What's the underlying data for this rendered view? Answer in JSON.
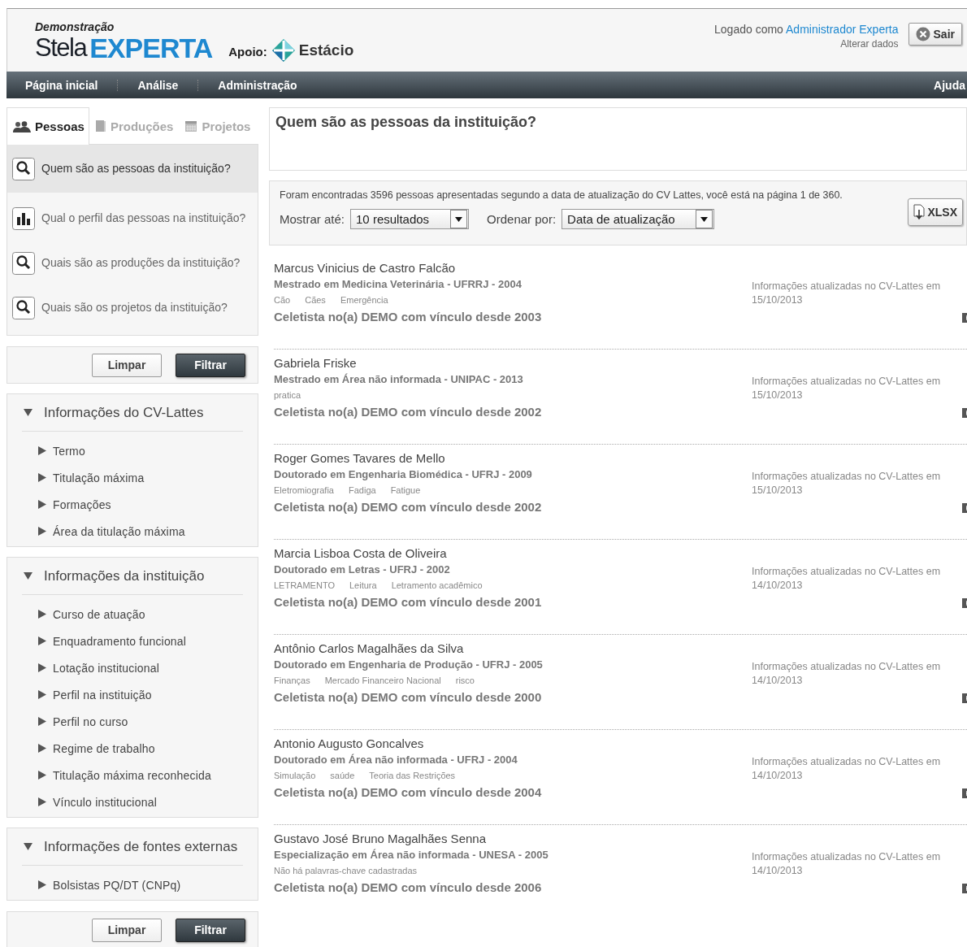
{
  "header": {
    "demo_label": "Demonstração",
    "logo_left": "Stela",
    "logo_right": "EXPERTA",
    "sponsor_label": "Apoio:",
    "sponsor_name": "Estácio",
    "login_prefix": "Logado como",
    "user_name": "Administrador Experta",
    "edit_link": "Alterar dados",
    "logout_button": "Sair"
  },
  "nav": {
    "items": [
      "Página inicial",
      "Análise",
      "Administração"
    ],
    "help": "Ajuda"
  },
  "tabs": [
    {
      "label": "Pessoas",
      "kind": "people",
      "selected": true
    },
    {
      "label": "Produções",
      "kind": "book",
      "selected": false
    },
    {
      "label": "Projetos",
      "kind": "calendar",
      "selected": false
    }
  ],
  "questions": [
    {
      "label": "Quem são as pessoas da instituição?",
      "kind": "search",
      "selected": true
    },
    {
      "label": "Qual o perfil das pessoas na instituição?",
      "kind": "chart",
      "selected": false
    },
    {
      "label": "Quais são as produções da instituição?",
      "kind": "search",
      "selected": false
    },
    {
      "label": "Quais são os projetos da instituição?",
      "kind": "search",
      "selected": false
    }
  ],
  "filter_buttons": {
    "clear": "Limpar",
    "apply": "Filtrar"
  },
  "filter_groups": [
    {
      "title": "Informações do CV-Lattes",
      "expanded": true,
      "items": [
        {
          "label": "Termo",
          "expanded": false
        },
        {
          "label": "Titulação máxima",
          "expanded": false
        },
        {
          "label": "Formações",
          "expanded": false
        },
        {
          "label": "Área da titulação máxima",
          "expanded": false
        }
      ]
    },
    {
      "title": "Informações da instituição",
      "expanded": true,
      "items": [
        {
          "label": "Curso de atuação",
          "expanded": false
        },
        {
          "label": "Enquadramento funcional",
          "expanded": false
        },
        {
          "label": "Lotação institucional",
          "expanded": false
        },
        {
          "label": "Perfil na instituição",
          "expanded": false
        },
        {
          "label": "Perfil no curso",
          "expanded": false
        },
        {
          "label": "Regime de trabalho",
          "expanded": false
        },
        {
          "label": "Titulação máxima reconhecida",
          "expanded": false
        },
        {
          "label": "Vínculo institucional",
          "expanded": false
        }
      ]
    },
    {
      "title": "Informações de fontes externas",
      "expanded": true,
      "items": [
        {
          "label": "Bolsistas PQ/DT (CNPq)",
          "expanded": false
        }
      ]
    }
  ],
  "bottom_filter_buttons": {
    "clear": "Limpar",
    "apply": "Filtrar"
  },
  "page_title": "Quem são as pessoas da instituição?",
  "summary": "Foram encontradas 3596 pessoas apresentadas segundo a data de atualização do CV Lattes, você está na página 1 de 360.",
  "show_label": "Mostrar até:",
  "show_value": "10 resultados",
  "order_label": "Ordenar por:",
  "order_value": "Data de atualização",
  "export_button": "XLSX",
  "results": [
    {
      "name": "Marcus Vinicius de Castro Falcão",
      "degree": "Mestrado em Medicina Veterinária - UFRRJ - 2004",
      "keywords": [
        "Cão",
        "Cães",
        "Emergência"
      ],
      "bond": "Celetista no(a) DEMO com vínculo desde 2003",
      "updated_label": "Informações atualizadas no CV-Lattes em",
      "updated_date": "15/10/2013"
    },
    {
      "name": "Gabriela Friske",
      "degree": "Mestrado em Área não informada - UNIPAC - 2013",
      "keywords": [
        "pratica"
      ],
      "bond": "Celetista no(a) DEMO com vínculo desde 2002",
      "updated_label": "Informações atualizadas no CV-Lattes em",
      "updated_date": "15/10/2013"
    },
    {
      "name": "Roger Gomes Tavares de Mello",
      "degree": "Doutorado em Engenharia Biomédica - UFRJ - 2009",
      "keywords": [
        "Eletromiografia",
        "Fadiga",
        "Fatigue"
      ],
      "bond": "Celetista no(a) DEMO com vínculo desde 2002",
      "updated_label": "Informações atualizadas no CV-Lattes em",
      "updated_date": "15/10/2013"
    },
    {
      "name": "Marcia Lisboa Costa de Oliveira",
      "degree": "Doutorado em Letras - UFRJ - 2002",
      "keywords": [
        "LETRAMENTO",
        "Leitura",
        "Letramento acadêmico"
      ],
      "bond": "Celetista no(a) DEMO com vínculo desde 2001",
      "updated_label": "Informações atualizadas no CV-Lattes em",
      "updated_date": "14/10/2013"
    },
    {
      "name": "Antônio Carlos Magalhães da Silva",
      "degree": "Doutorado em Engenharia de Produção - UFRJ - 2005",
      "keywords": [
        "Finanças",
        "Mercado Financeiro Nacional",
        "risco"
      ],
      "bond": "Celetista no(a) DEMO com vínculo desde 2000",
      "updated_label": "Informações atualizadas no CV-Lattes em",
      "updated_date": "14/10/2013"
    },
    {
      "name": "Antonio Augusto Goncalves",
      "degree": "Doutorado em Área não informada - UFRJ - 2004",
      "keywords": [
        "Simulação",
        "saúde",
        "Teoria das Restrições"
      ],
      "bond": "Celetista no(a) DEMO com vínculo desde 2004",
      "updated_label": "Informações atualizadas no CV-Lattes em",
      "updated_date": "14/10/2013"
    },
    {
      "name": "Gustavo José Bruno Magalhães Senna",
      "degree": "Especialização em Área não informada - UNESA - 2005",
      "keywords": [
        "Não há palavras-chave cadastradas"
      ],
      "bond": "Celetista no(a) DEMO com vínculo desde 2006",
      "updated_label": "Informações atualizadas no CV-Lattes em",
      "updated_date": "14/10/2013"
    }
  ]
}
